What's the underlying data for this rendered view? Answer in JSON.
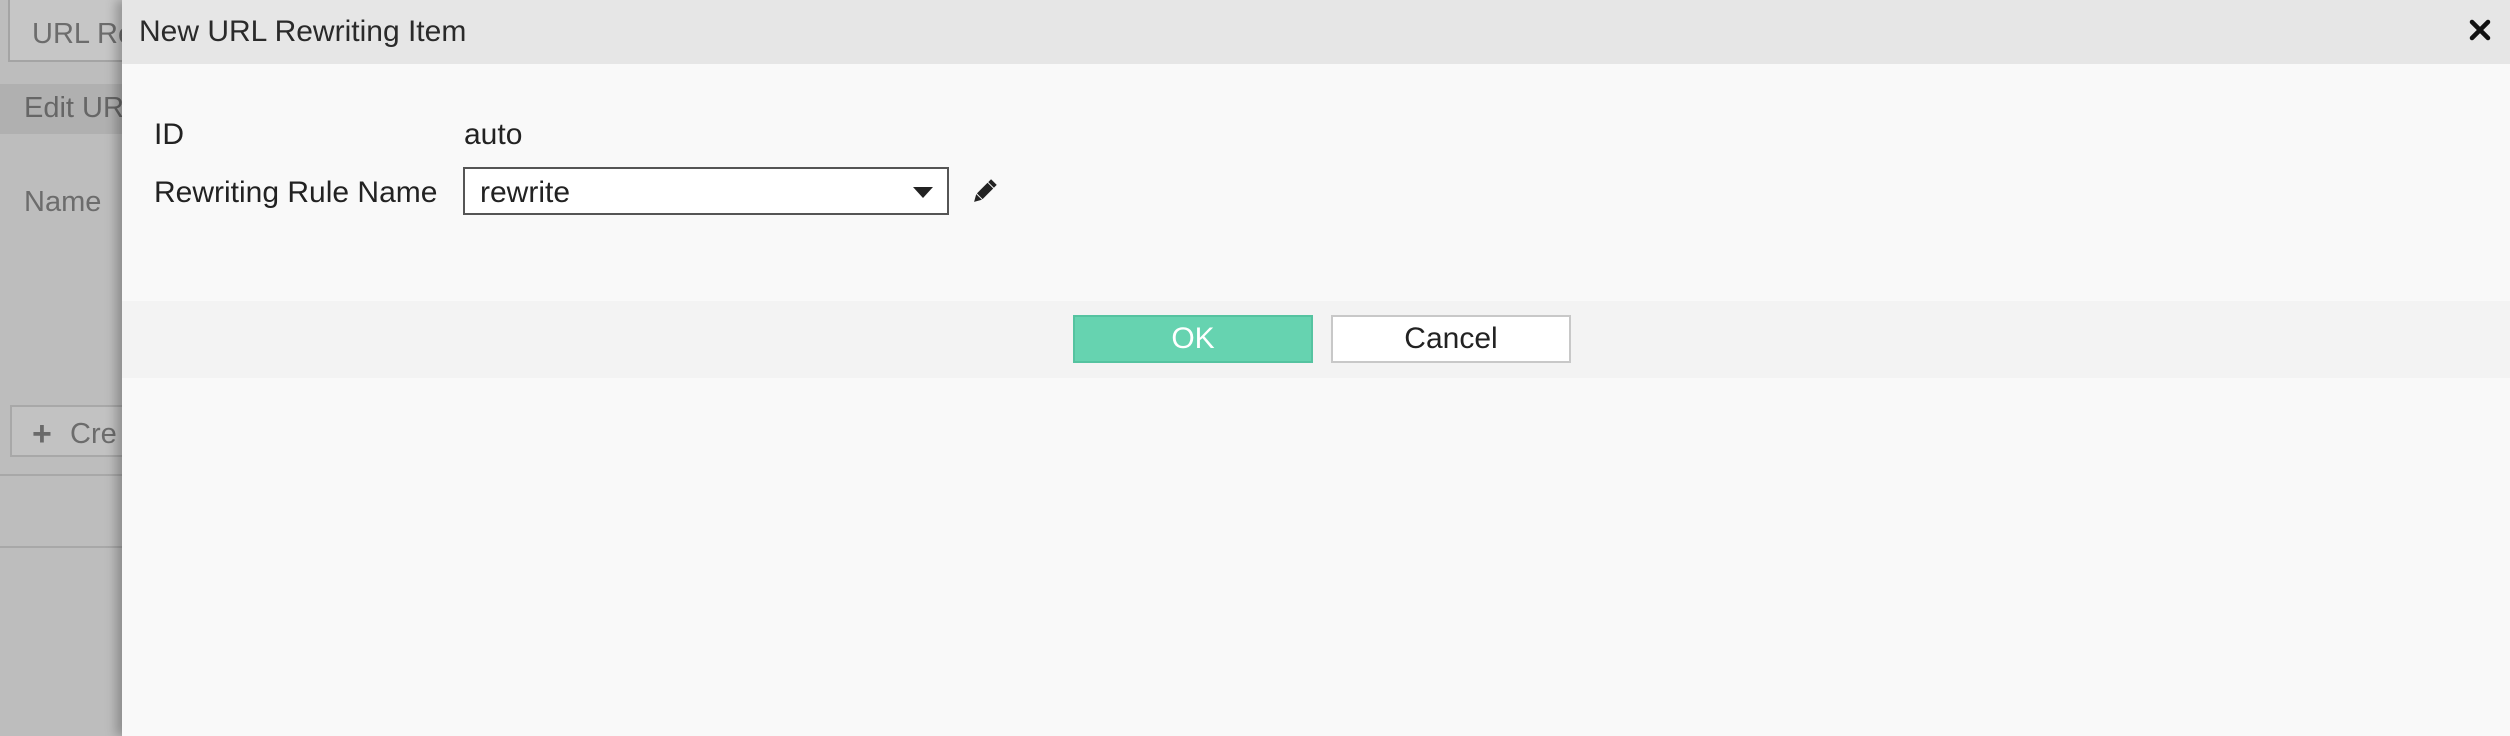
{
  "background": {
    "tab_label": "URL Re",
    "edit_label": "Edit UR",
    "name_label": "Name",
    "create_label": "Cre"
  },
  "dialog": {
    "title": "New URL Rewriting Item",
    "close_icon": "close-x-icon",
    "fields": {
      "id": {
        "label": "ID",
        "value": "auto"
      },
      "rule_name": {
        "label": "Rewriting Rule Name",
        "value": "rewrite"
      }
    },
    "buttons": {
      "ok": "OK",
      "cancel": "Cancel"
    }
  },
  "colors": {
    "ok_button": "#66d3b0",
    "header_bg": "#e6e6e6",
    "overlay_bg": "#bdbdbd"
  }
}
